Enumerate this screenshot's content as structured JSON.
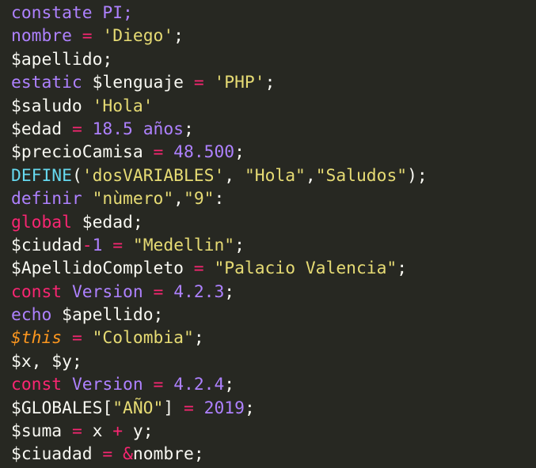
{
  "colors": {
    "background": "#272822",
    "default_text": "#f8f8f2",
    "keyword_pink": "#f92672",
    "number_purple": "#ae81ff",
    "string_yellow": "#e6db74",
    "builtin_cyan": "#66d9ef",
    "this_orange": "#fd971f"
  },
  "code_lines": [
    [
      {
        "t": "constate PI;",
        "c": "kw"
      }
    ],
    [
      {
        "t": "nombre",
        "c": "kw"
      },
      {
        "t": " = ",
        "c": "o"
      },
      {
        "t": "'Diego'",
        "c": "s"
      },
      {
        "t": ";",
        "c": "v"
      }
    ],
    [
      {
        "t": "$apellido;",
        "c": "v"
      }
    ],
    [
      {
        "t": "estatic",
        "c": "kw"
      },
      {
        "t": " $lenguaje ",
        "c": "v"
      },
      {
        "t": "=",
        "c": "o"
      },
      {
        "t": " ",
        "c": "v"
      },
      {
        "t": "'PHP'",
        "c": "s"
      },
      {
        "t": ";",
        "c": "v"
      }
    ],
    [
      {
        "t": "$saludo ",
        "c": "v"
      },
      {
        "t": "'Hola'",
        "c": "s"
      }
    ],
    [
      {
        "t": "$edad ",
        "c": "v"
      },
      {
        "t": "=",
        "c": "o"
      },
      {
        "t": " ",
        "c": "v"
      },
      {
        "t": "18.5",
        "c": "n"
      },
      {
        "t": " ",
        "c": "v"
      },
      {
        "t": "años",
        "c": "kw"
      },
      {
        "t": ";",
        "c": "v"
      }
    ],
    [
      {
        "t": "$precioCamisa ",
        "c": "v"
      },
      {
        "t": "=",
        "c": "o"
      },
      {
        "t": " ",
        "c": "v"
      },
      {
        "t": "48.500",
        "c": "n"
      },
      {
        "t": ";",
        "c": "v"
      }
    ],
    [
      {
        "t": "DEFINE",
        "c": "b"
      },
      {
        "t": "(",
        "c": "v"
      },
      {
        "t": "'dosVARIABLES'",
        "c": "s"
      },
      {
        "t": ", ",
        "c": "v"
      },
      {
        "t": "\"Hola\"",
        "c": "s"
      },
      {
        "t": ",",
        "c": "v"
      },
      {
        "t": "\"Saludos\"",
        "c": "s"
      },
      {
        "t": ");",
        "c": "v"
      }
    ],
    [
      {
        "t": "definir",
        "c": "kw"
      },
      {
        "t": " ",
        "c": "v"
      },
      {
        "t": "\"nùmero\"",
        "c": "s"
      },
      {
        "t": ",",
        "c": "v"
      },
      {
        "t": "\"9\"",
        "c": "s"
      },
      {
        "t": ":",
        "c": "v"
      }
    ],
    [
      {
        "t": "global",
        "c": "k"
      },
      {
        "t": " $edad;",
        "c": "v"
      }
    ],
    [
      {
        "t": "$ciudad",
        "c": "v"
      },
      {
        "t": "-",
        "c": "o"
      },
      {
        "t": "1",
        "c": "n"
      },
      {
        "t": " ",
        "c": "v"
      },
      {
        "t": "=",
        "c": "o"
      },
      {
        "t": " ",
        "c": "v"
      },
      {
        "t": "\"Medellin\"",
        "c": "s"
      },
      {
        "t": ";",
        "c": "v"
      }
    ],
    [
      {
        "t": "$ApellidoCompleto ",
        "c": "v"
      },
      {
        "t": "=",
        "c": "o"
      },
      {
        "t": " ",
        "c": "v"
      },
      {
        "t": "\"Palacio Valencia\"",
        "c": "s"
      },
      {
        "t": ";",
        "c": "v"
      }
    ],
    [
      {
        "t": "const",
        "c": "k"
      },
      {
        "t": " ",
        "c": "v"
      },
      {
        "t": "Version",
        "c": "kw"
      },
      {
        "t": " ",
        "c": "v"
      },
      {
        "t": "=",
        "c": "o"
      },
      {
        "t": " ",
        "c": "v"
      },
      {
        "t": "4.2.3",
        "c": "n"
      },
      {
        "t": ";",
        "c": "v"
      }
    ],
    [
      {
        "t": "echo",
        "c": "kw"
      },
      {
        "t": " $apellido;",
        "c": "v"
      }
    ],
    [
      {
        "t": "$this",
        "c": "t"
      },
      {
        "t": " ",
        "c": "v"
      },
      {
        "t": "=",
        "c": "o"
      },
      {
        "t": " ",
        "c": "v"
      },
      {
        "t": "\"Colombia\"",
        "c": "s"
      },
      {
        "t": ";",
        "c": "v"
      }
    ],
    [
      {
        "t": "$x, $y;",
        "c": "v"
      }
    ],
    [
      {
        "t": "const",
        "c": "k"
      },
      {
        "t": " ",
        "c": "v"
      },
      {
        "t": "Version",
        "c": "kw"
      },
      {
        "t": " ",
        "c": "v"
      },
      {
        "t": "=",
        "c": "o"
      },
      {
        "t": " ",
        "c": "v"
      },
      {
        "t": "4.2.4",
        "c": "n"
      },
      {
        "t": ";",
        "c": "v"
      }
    ],
    [
      {
        "t": "$GLOBALES[",
        "c": "v"
      },
      {
        "t": "\"AÑO\"",
        "c": "s"
      },
      {
        "t": "] ",
        "c": "v"
      },
      {
        "t": "=",
        "c": "o"
      },
      {
        "t": " ",
        "c": "v"
      },
      {
        "t": "2019",
        "c": "n"
      },
      {
        "t": ";",
        "c": "v"
      }
    ],
    [
      {
        "t": "$suma ",
        "c": "v"
      },
      {
        "t": "=",
        "c": "o"
      },
      {
        "t": " x ",
        "c": "v"
      },
      {
        "t": "+",
        "c": "o"
      },
      {
        "t": " y;",
        "c": "v"
      }
    ],
    [
      {
        "t": "$ciuadad ",
        "c": "v"
      },
      {
        "t": "=",
        "c": "o"
      },
      {
        "t": " ",
        "c": "v"
      },
      {
        "t": "&",
        "c": "o"
      },
      {
        "t": "nombre;",
        "c": "v"
      }
    ]
  ]
}
